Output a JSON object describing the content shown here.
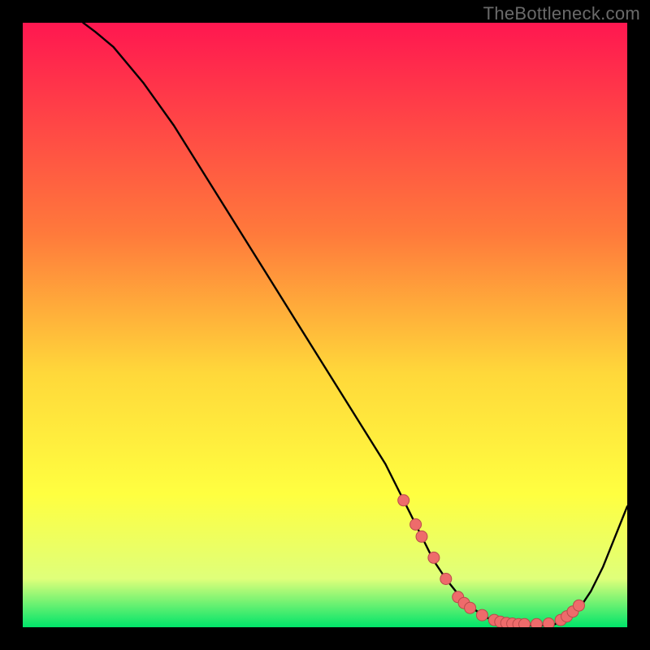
{
  "watermark": "TheBottleneck.com",
  "colors": {
    "frame_bg": "#000000",
    "gradient_top": "#ff1750",
    "gradient_mid1": "#ff7a3b",
    "gradient_mid2": "#ffd83a",
    "gradient_mid3": "#ffff40",
    "gradient_mid4": "#dfff7a",
    "gradient_bottom": "#00e46a",
    "curve": "#000000",
    "dot_fill": "#ee6b6b",
    "dot_stroke": "#b94b4b"
  },
  "chart_data": {
    "type": "line",
    "title": "",
    "xlabel": "",
    "ylabel": "",
    "xlim": [
      0,
      100
    ],
    "ylim": [
      0,
      100
    ],
    "series": [
      {
        "name": "bottleneck-curve",
        "x": [
          10,
          12,
          15,
          20,
          25,
          30,
          35,
          40,
          45,
          50,
          55,
          60,
          62,
          64,
          66,
          68,
          70,
          72,
          74,
          76,
          78,
          80,
          82,
          84,
          86,
          88,
          90,
          92,
          94,
          96,
          100
        ],
        "y": [
          100,
          98.5,
          96,
          90,
          83,
          75,
          67,
          59,
          51,
          43,
          35,
          27,
          23,
          19,
          15,
          11,
          8,
          5.5,
          3.5,
          2,
          1,
          0.5,
          0.3,
          0.3,
          0.3,
          0.5,
          1.5,
          3,
          6,
          10,
          20
        ]
      }
    ],
    "points": {
      "name": "highlighted-dots",
      "x": [
        63,
        65,
        66,
        68,
        70,
        72,
        73,
        74,
        76,
        78,
        79,
        80,
        81,
        82,
        83,
        85,
        87,
        89,
        90,
        91,
        92
      ],
      "y": [
        21,
        17,
        15,
        11.5,
        8,
        5,
        4,
        3.2,
        2,
        1.2,
        0.9,
        0.7,
        0.6,
        0.5,
        0.5,
        0.5,
        0.6,
        1.2,
        1.8,
        2.6,
        3.6
      ]
    }
  }
}
